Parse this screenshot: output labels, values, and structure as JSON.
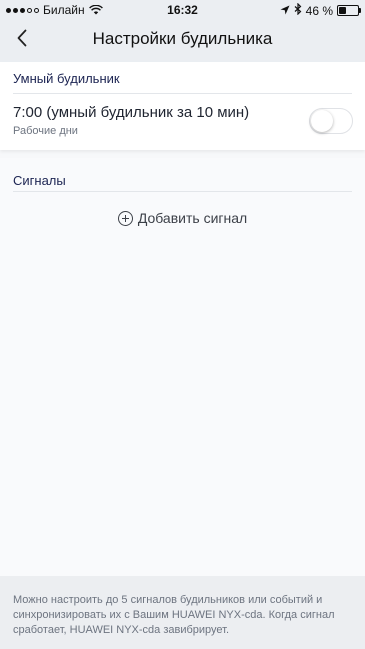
{
  "status_bar": {
    "carrier": "Билайн",
    "time": "16:32",
    "battery_percent_text": "46 %",
    "battery_level": 0.46,
    "icons": [
      "signal-icon",
      "wifi-icon",
      "location-icon",
      "bluetooth-icon",
      "battery-icon"
    ]
  },
  "header": {
    "title": "Настройки будильника",
    "back_icon": "chevron-left-icon"
  },
  "smart_alarm": {
    "heading": "Умный будильник",
    "alarm": {
      "title": "7:00 (умный будильник за 10 мин)",
      "subtitle": "Рабочие дни",
      "enabled": false
    }
  },
  "signals": {
    "heading": "Сигналы",
    "add_label": "Добавить сигнал",
    "add_icon": "plus-circle-icon"
  },
  "footer": {
    "note": "Можно настроить до 5 сигналов будильников или событий и синхронизировать их с Вашим HUAWEI NYX-cda. Когда сигнал сработает, HUAWEI NYX-cda завибрирует."
  },
  "colors": {
    "header_background": "#ebeef2",
    "section_heading": "#1c2452",
    "footer_background": "#eceef1"
  }
}
